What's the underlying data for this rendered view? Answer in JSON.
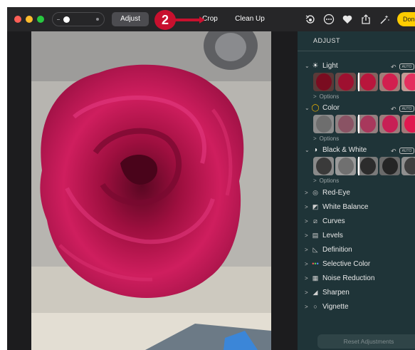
{
  "toolbar": {
    "adjust_label": "Adjust",
    "crop_label": "Crop",
    "cleanup_label": "Clean Up",
    "done_label": "Done",
    "callout_number": "2",
    "icons": [
      "rotate-icon",
      "more-icon",
      "favorite-heart-icon",
      "share-icon",
      "magic-wand-icon"
    ]
  },
  "colors": {
    "accent_yellow": "#ffcc00",
    "callout_red": "#c8102e",
    "panel_bg": "#1f3438",
    "window_bg": "#1c1c1e",
    "rose": "#c2185b",
    "selection_blue": "#2a7fff"
  },
  "panel": {
    "header": "ADJUST",
    "sections": [
      {
        "label": "Light",
        "icon": "sun-icon",
        "options_label": "Options",
        "auto_label": "AUTO"
      },
      {
        "label": "Color",
        "icon": "color-circle-icon",
        "options_label": "Options",
        "auto_label": "AUTO"
      },
      {
        "label": "Black & White",
        "icon": "half-circle-icon",
        "options_label": "Options",
        "auto_label": "AUTO"
      }
    ],
    "rows": [
      {
        "label": "Red-Eye",
        "icon": "eye-icon"
      },
      {
        "label": "White Balance",
        "icon": "white-balance-icon"
      },
      {
        "label": "Curves",
        "icon": "curves-icon"
      },
      {
        "label": "Levels",
        "icon": "levels-icon"
      },
      {
        "label": "Definition",
        "icon": "triangle-icon"
      },
      {
        "label": "Selective Color",
        "icon": "selective-color-icon"
      },
      {
        "label": "Noise Reduction",
        "icon": "noise-icon"
      },
      {
        "label": "Sharpen",
        "icon": "sharpen-icon"
      },
      {
        "label": "Vignette",
        "icon": "vignette-icon"
      }
    ],
    "reset_label": "Reset Adjustments"
  }
}
